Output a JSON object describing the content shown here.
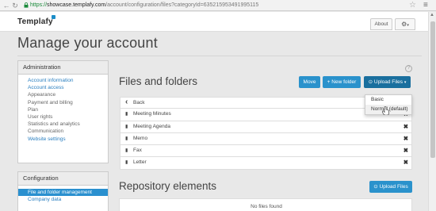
{
  "browser": {
    "url_scheme": "https://",
    "url_host": "showcase.templafy.com",
    "url_path": "/account/configuration/files?categoryId=635215953491995115"
  },
  "header": {
    "logo_text": "Templafy",
    "about_label": "About"
  },
  "page": {
    "title": "Manage your account"
  },
  "sidebar": {
    "administration": {
      "heading": "Administration",
      "items": [
        {
          "label": "Account information",
          "link": true
        },
        {
          "label": "Account access",
          "link": true
        },
        {
          "label": "Appearance",
          "link": false
        },
        {
          "label": "Payment and billing",
          "link": false
        },
        {
          "label": "Plan",
          "link": false
        },
        {
          "label": "User rights",
          "link": false
        },
        {
          "label": "Statistics and analytics",
          "link": false
        },
        {
          "label": "Communication",
          "link": false
        },
        {
          "label": "Website settings",
          "link": true
        }
      ]
    },
    "configuration": {
      "heading": "Configuration",
      "items": [
        {
          "label": "File and folder management",
          "active": true
        },
        {
          "label": "Company data",
          "link": true
        }
      ]
    }
  },
  "files": {
    "title": "Files and folders",
    "move_label": "Move",
    "new_folder_label": "+ New folder",
    "upload_label": "Upload Files",
    "rows": [
      {
        "label": "Back",
        "icon": "chevron-left-icon",
        "deletable": false
      },
      {
        "label": "Meeting Minutes",
        "icon": "file-icon",
        "deletable": true
      },
      {
        "label": "Meeting Agenda",
        "icon": "file-icon",
        "deletable": true
      },
      {
        "label": "Memo",
        "icon": "file-icon",
        "deletable": true
      },
      {
        "label": "Fax",
        "icon": "file-icon",
        "deletable": true
      },
      {
        "label": "Letter",
        "icon": "file-icon",
        "deletable": true
      }
    ],
    "delete_glyph": "✖",
    "upload_menu": [
      "Basic",
      "Normal (default)"
    ]
  },
  "repository": {
    "title": "Repository elements",
    "upload_label": "Upload Files",
    "empty_text": "No files found"
  },
  "colors": {
    "accent": "#2a92cc",
    "accent_dark": "#1a6f9e",
    "link": "#2a7fc0"
  }
}
